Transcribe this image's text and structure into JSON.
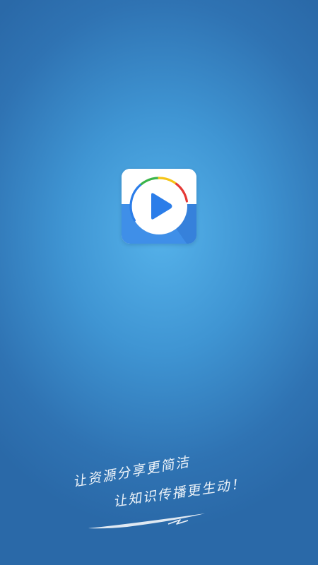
{
  "splash": {
    "slogan_line_1": "让资源分享更简洁",
    "slogan_line_2": "让知识传播更生动！"
  },
  "logo": {
    "icon": "play-icon",
    "colors": {
      "play": "#2b7de9",
      "bottom": "#3f8fe8",
      "ring_blue": "#2b7de9",
      "ring_green": "#3bb54a",
      "ring_yellow": "#f5c518",
      "ring_red": "#e53935"
    }
  },
  "background": {
    "center_color": "#55b2ea",
    "edge_color": "#2a69a8"
  }
}
